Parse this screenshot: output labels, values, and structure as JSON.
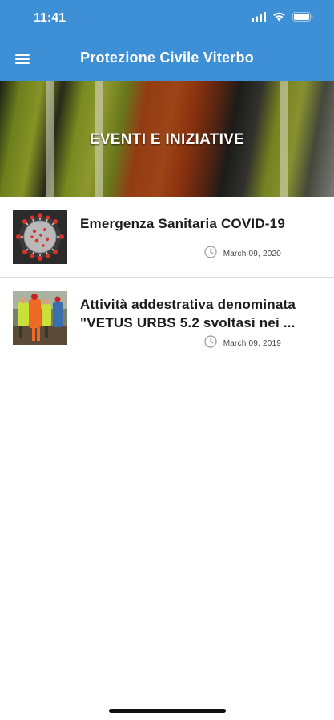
{
  "status_bar": {
    "time": "11:41",
    "icons": [
      "signal-icon",
      "wifi-icon",
      "battery-icon"
    ]
  },
  "navbar": {
    "title": "Protezione Civile Viterbo",
    "menu_icon": "hamburger-menu-icon",
    "background": "#3d8fd6"
  },
  "hero": {
    "title": "EVENTI E INIZIATIVE"
  },
  "events": [
    {
      "title": "Emergenza Sanitaria COVID-19",
      "date": "March 09, 2020",
      "thumbnail": "covid-virus-image"
    },
    {
      "title": "Attività addestrativa denominata \"VETUS URBS 5.2 svoltasi nei ...",
      "date": "March 09, 2019",
      "thumbnail": "rescue-team-photo"
    }
  ]
}
